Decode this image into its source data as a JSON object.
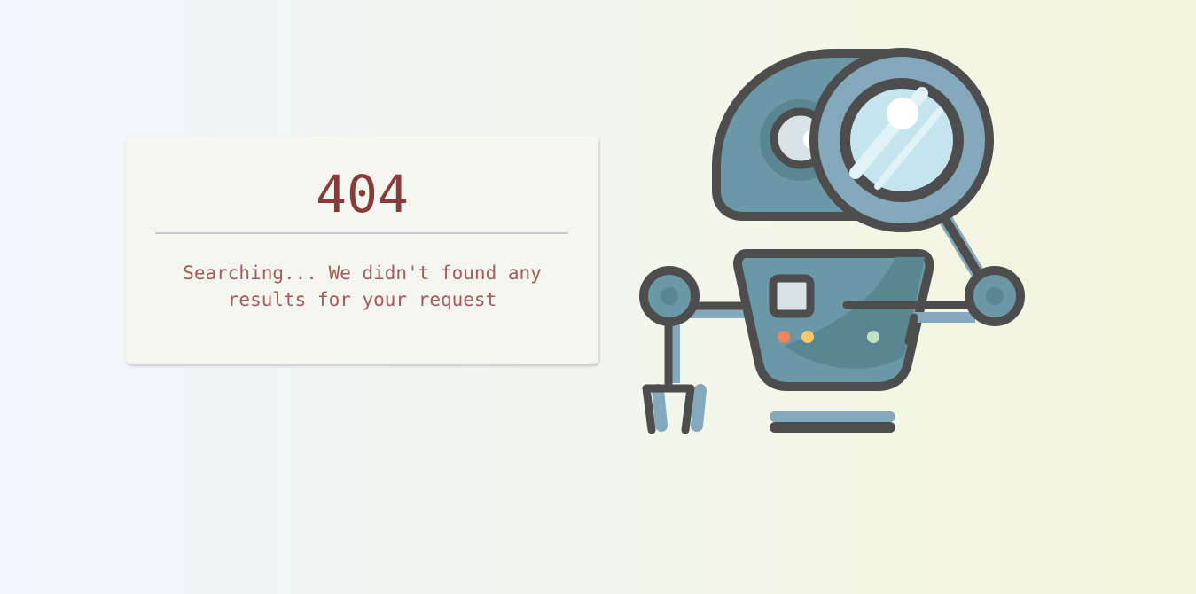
{
  "error": {
    "code": "404",
    "message": "Searching... We didn't found any results for your request"
  },
  "illustration": {
    "icon": "robot-with-magnifying-glass-icon"
  },
  "colors": {
    "code": "#8b3a3a",
    "message": "#a65a5a",
    "robot_outline": "#4d4d4d",
    "robot_body": "#6a98a6",
    "robot_light": "#84a9bc",
    "lens": "#d6eef5"
  }
}
